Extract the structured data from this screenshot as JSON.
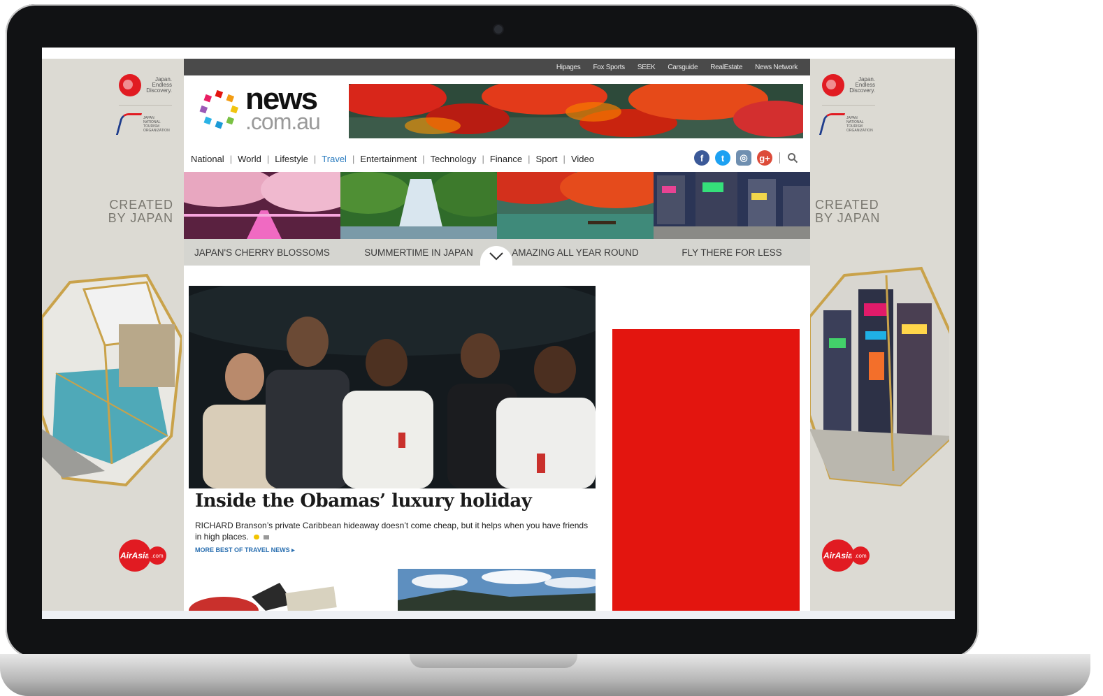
{
  "utility_links": [
    "Hipages",
    "Fox Sports",
    "SEEK",
    "Carsguide",
    "RealEstate",
    "News Network"
  ],
  "logo": {
    "word1": "news",
    "word2": ".com.au"
  },
  "nav": [
    {
      "label": "National",
      "active": false
    },
    {
      "label": "World",
      "active": false
    },
    {
      "label": "Lifestyle",
      "active": false
    },
    {
      "label": "Travel",
      "active": true
    },
    {
      "label": "Entertainment",
      "active": false
    },
    {
      "label": "Technology",
      "active": false
    },
    {
      "label": "Finance",
      "active": false
    },
    {
      "label": "Sport",
      "active": false
    },
    {
      "label": "Video",
      "active": false
    }
  ],
  "social": [
    {
      "name": "facebook-icon",
      "glyph": "f",
      "color": "#3b5998"
    },
    {
      "name": "twitter-icon",
      "glyph": "t",
      "color": "#1da1f2"
    },
    {
      "name": "instagram-icon",
      "glyph": "◎",
      "color": "#6f8fb0"
    },
    {
      "name": "google-plus-icon",
      "glyph": "g+",
      "color": "#dd4b39"
    }
  ],
  "tiles": [
    {
      "caption": "JAPAN'S CHERRY BLOSSOMS"
    },
    {
      "caption": "SUMMERTIME IN JAPAN"
    },
    {
      "caption": "AMAZING ALL YEAR ROUND"
    },
    {
      "caption": "FLY THERE FOR LESS"
    }
  ],
  "hero": {
    "headline": "Inside the Obamas’ luxury holiday",
    "standfirst": "RICHARD Branson’s private Caribbean hideaway doesn’t come cheap, but it helps when you have friends in high places.",
    "more_link": "MORE BEST OF TRAVEL NEWS ▸"
  },
  "skin": {
    "japan_tagline": "Japan. Endless Discovery.",
    "jnto_text": "JAPAN NATIONAL TOURISM ORGANIZATION",
    "created_line1": "CREATED",
    "created_line2": "BY JAPAN",
    "airasia": "AirAsia",
    "airasia_com": ".com"
  },
  "colors": {
    "accent": "#2a7bbf",
    "ad_red": "#e3150f",
    "util_bar": "#4a4a4a"
  }
}
